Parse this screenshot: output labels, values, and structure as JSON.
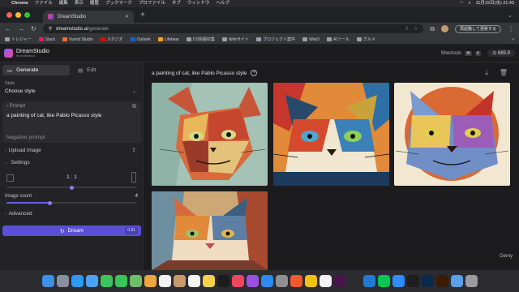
{
  "menubar": {
    "app": "Chrome",
    "items": [
      "ファイル",
      "編集",
      "表示",
      "履歴",
      "ブックマーク",
      "プロファイル",
      "タブ",
      "ウィンドウ",
      "ヘルプ"
    ],
    "datetime": "11月15日(水) 21:43"
  },
  "browser": {
    "tab_title": "DreamStudio",
    "url_host": "dreamstudio.ai",
    "url_path": "/generate",
    "restart_label": "再起動して更新する",
    "bookmarks": [
      "トレジャー",
      "Slack",
      "Vyond Studio",
      "スタジオ",
      "Outlook",
      "Lifebear",
      "DS情報収集",
      "Webサイト",
      "プロジェクト案件",
      "Web3",
      "AIツール",
      "グルメ"
    ]
  },
  "app": {
    "brand": "DreamStudio",
    "brand_sub": "by stability.ai",
    "shortcuts_label": "Shortcuts",
    "shortcut_key1": "⌘",
    "shortcut_key2": "K",
    "credits": "685.9"
  },
  "panel": {
    "generate_label": "Generate",
    "edit_label": "Edit",
    "style_label": "Style",
    "style_value": "Choose style",
    "prompt_label": "Prompt",
    "prompt_text": "a painting of cat,  like Pablo Picasso style",
    "negative_prompt_label": "Negative prompt",
    "upload_image_label": "Upload image",
    "settings_label": "Settings",
    "aspect_ratio": "1 : 1",
    "image_count_label": "Image count",
    "image_count": "4",
    "image_count_fraction": 0.33,
    "aspect_fraction": 0.5,
    "advanced_label": "Advanced",
    "dream_label": "Dream",
    "dream_cost": "0.91"
  },
  "main": {
    "prompt_title": "a painting of cat,  like Pablo Picasso style",
    "watermark": "Gemy"
  },
  "colors": {
    "accent": "#5b4fd8",
    "background": "#1c1c1f",
    "panel": "#232327"
  }
}
